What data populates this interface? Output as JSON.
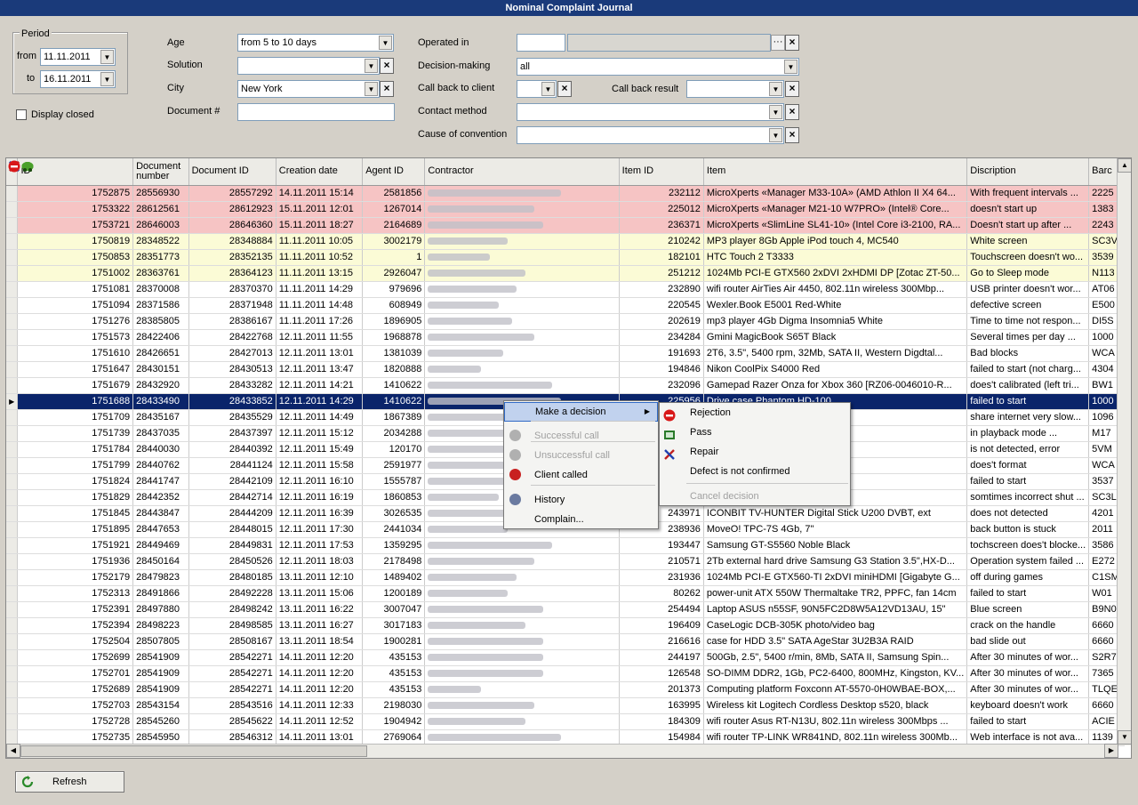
{
  "window": {
    "title": "Nominal Complaint Journal"
  },
  "filters": {
    "period_label": "Period",
    "from_label": "from",
    "from_value": "11.11.2011",
    "to_label": "to",
    "to_value": "16.11.2011",
    "display_closed_label": "Display closed",
    "age_label": "Age",
    "age_value": "from 5 to 10 days",
    "solution_label": "Solution",
    "solution_value": "",
    "city_label": "City",
    "city_value": "New York",
    "document_label": "Document #",
    "document_value": "",
    "operated_label": "Operated in",
    "operated_value": "",
    "decision_label": "Decision-making",
    "decision_value": "all",
    "callback_label": "Call back to client",
    "callback_value": "",
    "callback_result_label": "Call back result",
    "callback_result_value": "",
    "contact_label": "Contact method",
    "contact_value": "",
    "cause_label": "Cause of convention",
    "cause_value": ""
  },
  "grid": {
    "columns": [
      "ID",
      "Document number",
      "Document ID",
      "Creation date",
      "Agent ID",
      "Contractor",
      "Item ID",
      "Item",
      "Discription",
      "Barc"
    ],
    "rows": [
      {
        "icons": [
          "tools",
          "car"
        ],
        "id": "1752875",
        "docnum": "28556930",
        "docid": "28557292",
        "date": "14.11.2011 15:14",
        "agent": "2581856",
        "itemid": "232112",
        "item": "MicroXperts «Manager M33-10A» (AMD Athlon II X4 64...",
        "desc": "With frequent intervals ...",
        "barc": "2225",
        "style": "pink"
      },
      {
        "icons": [
          "tools",
          "car"
        ],
        "id": "1753322",
        "docnum": "28612561",
        "docid": "28612923",
        "date": "15.11.2011 12:01",
        "agent": "1267014",
        "itemid": "225012",
        "item": "MicroXperts «Manager M21-10 W7PRO» (Intel® Core...",
        "desc": "doesn't start up",
        "barc": "1383",
        "style": "pink"
      },
      {
        "icons": [
          "tools",
          "car"
        ],
        "id": "1753721",
        "docnum": "28646003",
        "docid": "28646360",
        "date": "15.11.2011 18:27",
        "agent": "2164689",
        "itemid": "236371",
        "item": "MicroXperts «SlimLine SL41-10» (Intel Core i3-2100, RA...",
        "desc": "Doesn't start up after ...",
        "barc": "2243",
        "style": "pink"
      },
      {
        "icons": [],
        "id": "1750819",
        "docnum": "28348522",
        "docid": "28348884",
        "date": "11.11.2011 10:05",
        "agent": "3002179",
        "itemid": "210242",
        "item": "MP3 player 8Gb Apple iPod touch 4, MC540",
        "desc": "White screen",
        "barc": "SC3V",
        "style": "yellow"
      },
      {
        "icons": [],
        "id": "1750853",
        "docnum": "28351773",
        "docid": "28352135",
        "date": "11.11.2011 10:52",
        "agent": "1",
        "itemid": "182101",
        "item": "HTC Touch 2  T3333",
        "desc": "Touchscreen doesn't wo...",
        "barc": "3539",
        "style": "yellow"
      },
      {
        "icons": [],
        "id": "1751002",
        "docnum": "28363761",
        "docid": "28364123",
        "date": "11.11.2011 13:15",
        "agent": "2926047",
        "itemid": "251212",
        "item": "1024Mb PCI-E GTX560 2xDVI 2xHDMI DP [Zotac ZT-50...",
        "desc": "Go to Sleep mode",
        "barc": "N113",
        "style": "yellow"
      },
      {
        "icons": [],
        "id": "1751081",
        "docnum": "28370008",
        "docid": "28370370",
        "date": "11.11.2011 14:29",
        "agent": "979696",
        "itemid": "232890",
        "item": "wifi router AirTies Air 4450, 802.11n wireless 300Mbp...",
        "desc": "USB printer doesn't wor...",
        "barc": "AT06",
        "style": ""
      },
      {
        "icons": [],
        "id": "1751094",
        "docnum": "28371586",
        "docid": "28371948",
        "date": "11.11.2011 14:48",
        "agent": "608949",
        "itemid": "220545",
        "item": "Wexler.Book E5001 Red-White",
        "desc": "defective screen",
        "barc": "E500",
        "style": ""
      },
      {
        "icons": [],
        "id": "1751276",
        "docnum": "28385805",
        "docid": "28386167",
        "date": "11.11.2011 17:26",
        "agent": "1896905",
        "itemid": "202619",
        "item": "mp3 player 4Gb Digma Insomnia5 White",
        "desc": "Time to time not respon...",
        "barc": "DI5S",
        "style": ""
      },
      {
        "icons": [],
        "id": "1751573",
        "docnum": "28422406",
        "docid": "28422768",
        "date": "12.11.2011 11:55",
        "agent": "1968878",
        "itemid": "234284",
        "item": "Gmini MagicBook S65T Black",
        "desc": "Several times per day ...",
        "barc": "1000",
        "style": ""
      },
      {
        "icons": [],
        "id": "1751610",
        "docnum": "28426651",
        "docid": "28427013",
        "date": "12.11.2011 13:01",
        "agent": "1381039",
        "itemid": "191693",
        "item": "2T6, 3.5\", 5400 rpm, 32Mb, SATA II, Western Digdtal...",
        "desc": "Bad blocks",
        "barc": "WCA",
        "style": ""
      },
      {
        "icons": [],
        "id": "1751647",
        "docnum": "28430151",
        "docid": "28430513",
        "date": "12.11.2011 13:47",
        "agent": "1820888",
        "itemid": "194846",
        "item": "Nikon CoolPix S4000 Red",
        "desc": "failed to start (not charg...",
        "barc": "4304",
        "style": ""
      },
      {
        "icons": [],
        "id": "1751679",
        "docnum": "28432920",
        "docid": "28433282",
        "date": "12.11.2011 14:21",
        "agent": "1410622",
        "itemid": "232096",
        "item": "Gamepad Razer Onza for Xbox 360 [RZ06-0046010-R...",
        "desc": "does't calibrated (left tri...",
        "barc": "BW1",
        "style": ""
      },
      {
        "icons": [],
        "id": "1751688",
        "docnum": "28433490",
        "docid": "28433852",
        "date": "12.11.2011 14:29",
        "agent": "1410622",
        "itemid": "225956",
        "item": "Drive case Phantom HD-100",
        "desc": "failed to start",
        "barc": "1000",
        "style": "sel"
      },
      {
        "icons": [],
        "id": "1751709",
        "docnum": "28435167",
        "docid": "28435529",
        "date": "12.11.2011 14:49",
        "agent": "1867389",
        "itemid": "",
        "item": "ND, 802.11n Wireless 300...",
        "desc": "share internet very slow...",
        "barc": "1096",
        "style": ""
      },
      {
        "icons": [],
        "id": "1751739",
        "docnum": "28437035",
        "docid": "28437397",
        "date": "12.11.2011 15:12",
        "agent": "2034288",
        "itemid": "",
        "item": "-300/W, 4.3\" TFT",
        "desc": "in playback mode ...",
        "barc": "M17",
        "style": ""
      },
      {
        "icons": [],
        "id": "1751784",
        "docnum": "28440030",
        "docid": "28440392",
        "date": "12.11.2011 15:49",
        "agent": "120170",
        "itemid": "",
        "item": "gate Barracuda 7200.12 [...",
        "desc": "is not detected, error",
        "barc": "5VM",
        "style": ""
      },
      {
        "icons": [],
        "id": "1751799",
        "docnum": "28440762",
        "docid": "28441124",
        "date": "12.11.2011 15:58",
        "agent": "2591977",
        "itemid": "",
        "item": "Western Digital My Book E...",
        "desc": "does't format",
        "barc": "WCA",
        "style": ""
      },
      {
        "icons": [],
        "id": "1751824",
        "docnum": "28441747",
        "docid": "28442109",
        "date": "12.11.2011 16:10",
        "agent": "1555787",
        "itemid": "",
        "item": "104",
        "desc": "failed to start",
        "barc": "3537",
        "style": ""
      },
      {
        "icons": [],
        "id": "1751829",
        "docnum": "28442352",
        "docid": "28442714",
        "date": "12.11.2011 16:19",
        "agent": "1860853",
        "itemid": "",
        "item": "ouch 4, MC544",
        "desc": "somtimes incorrect shut ...",
        "barc": "SC3L",
        "style": ""
      },
      {
        "icons": [],
        "id": "1751845",
        "docnum": "28443847",
        "docid": "28444209",
        "date": "12.11.2011 16:39",
        "agent": "3026535",
        "itemid": "243971",
        "item": "ICONBIT TV-HUNTER Digital Stick U200 DVBT, ext",
        "desc": "does not detected",
        "barc": "4201",
        "style": ""
      },
      {
        "icons": [],
        "id": "1751895",
        "docnum": "28447653",
        "docid": "28448015",
        "date": "12.11.2011 17:30",
        "agent": "2441034",
        "itemid": "238936",
        "item": "MoveO! TPC-7S 4Gb, 7\"",
        "desc": "back button is stuck",
        "barc": "2011",
        "style": ""
      },
      {
        "icons": [],
        "id": "1751921",
        "docnum": "28449469",
        "docid": "28449831",
        "date": "12.11.2011 17:53",
        "agent": "1359295",
        "itemid": "193447",
        "item": "Samsung GT-S5560 Noble Black",
        "desc": "tochscreen does't blocke...",
        "barc": "3586",
        "style": ""
      },
      {
        "icons": [],
        "id": "1751936",
        "docnum": "28450164",
        "docid": "28450526",
        "date": "12.11.2011 18:03",
        "agent": "2178498",
        "itemid": "210571",
        "item": "2Tb external hard drive Samsung G3 Station 3.5\",HX-D...",
        "desc": "Operation system failed ...",
        "barc": "E272",
        "style": ""
      },
      {
        "icons": [],
        "id": "1752179",
        "docnum": "28479823",
        "docid": "28480185",
        "date": "13.11.2011 12:10",
        "agent": "1489402",
        "itemid": "231936",
        "item": "1024Mb PCI-E GTX560-TI 2xDVI miniHDMI [Gigabyte G...",
        "desc": "off during games",
        "barc": "C1SM",
        "style": ""
      },
      {
        "icons": [],
        "id": "1752313",
        "docnum": "28491866",
        "docid": "28492228",
        "date": "13.11.2011 15:06",
        "agent": "1200189",
        "itemid": "80262",
        "item": "power-unit ATX 550W Thermaltake TR2, PPFC, fan 14cm",
        "desc": "failed to start",
        "barc": "W01",
        "style": ""
      },
      {
        "icons": [],
        "id": "1752391",
        "docnum": "28497880",
        "docid": "28498242",
        "date": "13.11.2011 16:22",
        "agent": "3007047",
        "itemid": "254494",
        "item": "Laptop ASUS n55SF, 90N5FC2D8W5A12VD13AU, 15\"",
        "desc": "Blue screen",
        "barc": "B9N0",
        "style": ""
      },
      {
        "icons": [],
        "id": "1752394",
        "docnum": "28498223",
        "docid": "28498585",
        "date": "13.11.2011 16:27",
        "agent": "3017183",
        "itemid": "196409",
        "item": "CaseLogic DCB-305K photo/video bag",
        "desc": "crack on the handle",
        "barc": "6660",
        "style": ""
      },
      {
        "icons": [],
        "id": "1752504",
        "docnum": "28507805",
        "docid": "28508167",
        "date": "13.11.2011 18:54",
        "agent": "1900281",
        "itemid": "216616",
        "item": "case for HDD 3.5\" SATA AgeStar 3U2B3A RAID",
        "desc": "bad slide out",
        "barc": "6660",
        "style": ""
      },
      {
        "icons": [],
        "id": "1752699",
        "docnum": "28541909",
        "docid": "28542271",
        "date": "14.11.2011 12:20",
        "agent": "435153",
        "itemid": "244197",
        "item": "500Gb, 2.5\", 5400 r/min, 8Mb, SATA II, Samsung Spin...",
        "desc": "After 30 minutes of wor...",
        "barc": "S2R7",
        "style": ""
      },
      {
        "icons": [],
        "id": "1752701",
        "docnum": "28541909",
        "docid": "28542271",
        "date": "14.11.2011 12:20",
        "agent": "435153",
        "itemid": "126548",
        "item": "SO-DIMM DDR2, 1Gb, PC2-6400, 800MHz, Kingston, KV...",
        "desc": "After 30 minutes of wor...",
        "barc": "7365",
        "style": ""
      },
      {
        "icons": [],
        "id": "1752689",
        "docnum": "28541909",
        "docid": "28542271",
        "date": "14.11.2011 12:20",
        "agent": "435153",
        "itemid": "201373",
        "item": "Computing platform Foxconn AT-5570-0H0WBAE-BOX,...",
        "desc": "After 30 minutes of wor...",
        "barc": "TLQE",
        "style": ""
      },
      {
        "icons": [
          "stop",
          "car"
        ],
        "id": "1752703",
        "docnum": "28543154",
        "docid": "28543516",
        "date": "14.11.2011 12:33",
        "agent": "2198030",
        "itemid": "163995",
        "item": "Wireless kit Logitech Cordless Desktop s520, black",
        "desc": "keyboard doesn't work",
        "barc": "6660",
        "style": ""
      },
      {
        "icons": [],
        "id": "1752728",
        "docnum": "28545260",
        "docid": "28545622",
        "date": "14.11.2011 12:52",
        "agent": "1904942",
        "itemid": "184309",
        "item": "wifi router Asus RT-N13U, 802.11n wireless 300Mbps ...",
        "desc": "failed to start",
        "barc": "ACIE",
        "style": ""
      },
      {
        "icons": [],
        "id": "1752735",
        "docnum": "28545950",
        "docid": "28546312",
        "date": "14.11.2011 13:01",
        "agent": "2769064",
        "itemid": "154984",
        "item": "wifi router TP-LINK WR841ND, 802.11n wireless 300Mb...",
        "desc": "Web interface is not ava...",
        "barc": "1139",
        "style": ""
      }
    ]
  },
  "context_menu": {
    "items": [
      {
        "label": "Make a decision",
        "state": "hl",
        "icon": "",
        "arrow": true
      },
      {
        "label": "Successful call",
        "state": "dis",
        "icon": "phone-icon"
      },
      {
        "label": "Unsuccessful call",
        "state": "dis",
        "icon": "phone-icon"
      },
      {
        "label": "Client called",
        "state": "",
        "icon": "client-icon"
      },
      {
        "label": "History",
        "state": "",
        "icon": "history-icon"
      },
      {
        "label": "Complain...",
        "state": "",
        "icon": ""
      }
    ]
  },
  "submenu": {
    "items": [
      {
        "label": "Rejection",
        "state": "",
        "icon": "stop"
      },
      {
        "label": "Pass",
        "state": "",
        "icon": "pass"
      },
      {
        "label": "Repair",
        "state": "",
        "icon": "tools"
      },
      {
        "label": "Defect is not confirmed",
        "state": "",
        "icon": ""
      },
      {
        "label": "Cancel decision",
        "state": "dis",
        "icon": ""
      }
    ]
  },
  "footer": {
    "refresh_label": "Refresh"
  },
  "colors": {
    "title_bg": "#1a3a7a",
    "pink_row": "#f6c4c4",
    "yellow_row": "#fbfbd6",
    "selected_row": "#0a246a"
  }
}
